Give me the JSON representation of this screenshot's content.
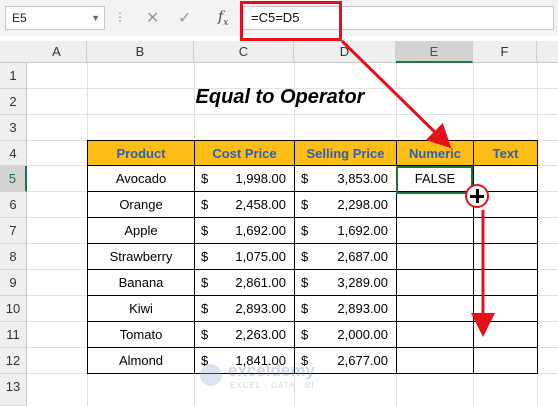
{
  "formula_bar": {
    "name_box": "E5",
    "formula": "=C5=D5",
    "fx_label": "fx"
  },
  "columns": [
    "A",
    "B",
    "C",
    "D",
    "E",
    "F"
  ],
  "rows": [
    "1",
    "2",
    "3",
    "4",
    "5",
    "6",
    "7",
    "8",
    "9",
    "10",
    "11",
    "12",
    "13"
  ],
  "sheet": {
    "title": "Equal to Operator",
    "headers": [
      "Product",
      "Cost Price",
      "Selling Price",
      "Numeric",
      "Text"
    ],
    "currency": "$",
    "products": [
      {
        "product": "Avocado",
        "cost": "1,998.00",
        "sell": "3,853.00",
        "numeric": "FALSE",
        "text": ""
      },
      {
        "product": "Orange",
        "cost": "2,458.00",
        "sell": "2,298.00",
        "numeric": "",
        "text": ""
      },
      {
        "product": "Apple",
        "cost": "1,692.00",
        "sell": "1,692.00",
        "numeric": "",
        "text": ""
      },
      {
        "product": "Strawberry",
        "cost": "1,075.00",
        "sell": "2,687.00",
        "numeric": "",
        "text": ""
      },
      {
        "product": "Banana",
        "cost": "2,861.00",
        "sell": "3,289.00",
        "numeric": "",
        "text": ""
      },
      {
        "product": "Kiwi",
        "cost": "2,893.00",
        "sell": "2,893.00",
        "numeric": "",
        "text": ""
      },
      {
        "product": "Tomato",
        "cost": "2,263.00",
        "sell": "2,000.00",
        "numeric": "",
        "text": ""
      },
      {
        "product": "Almond",
        "cost": "1,841.00",
        "sell": "2,677.00",
        "numeric": "",
        "text": ""
      }
    ]
  },
  "selection": {
    "cell": "E5",
    "column": "E",
    "row": "5"
  },
  "watermark": {
    "name": "exceldemy",
    "tagline": "EXCEL · DATA · BI"
  },
  "colors": {
    "header_fill": "#fdbd17",
    "header_text": "#2f5fb0",
    "annotation": "#e5101a",
    "selection": "#217346"
  }
}
